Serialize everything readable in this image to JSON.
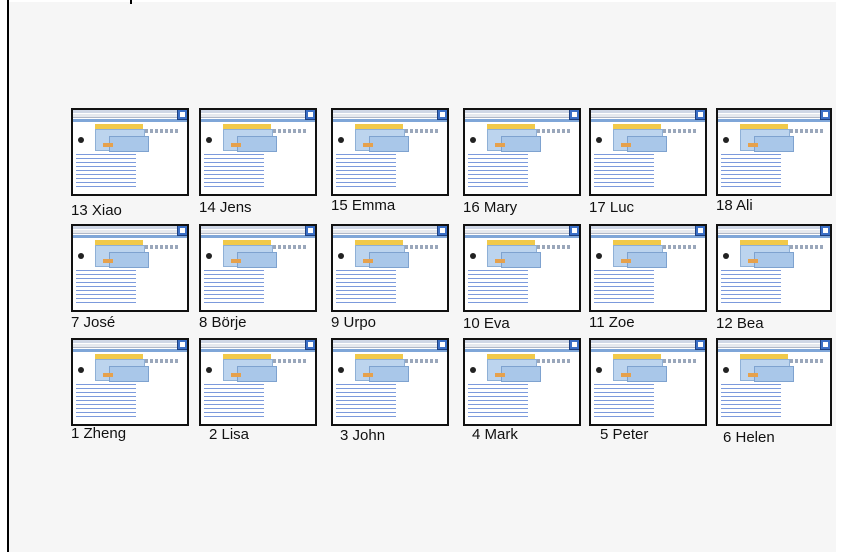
{
  "tiles": [
    {
      "label": "13 Xiao"
    },
    {
      "label": "14 Jens"
    },
    {
      "label": "15 Emma"
    },
    {
      "label": "16 Mary"
    },
    {
      "label": "17 Luc"
    },
    {
      "label": "18 Ali"
    },
    {
      "label": "7 José"
    },
    {
      "label": "8 Börje"
    },
    {
      "label": "9 Urpo"
    },
    {
      "label": "10 Eva"
    },
    {
      "label": "11 Zoe"
    },
    {
      "label": "12 Bea"
    },
    {
      "label": "1 Zheng"
    },
    {
      "label": "2 Lisa"
    },
    {
      "label": "3 John"
    },
    {
      "label": "4 Mark"
    },
    {
      "label": "5 Peter"
    },
    {
      "label": "6 Helen"
    }
  ]
}
